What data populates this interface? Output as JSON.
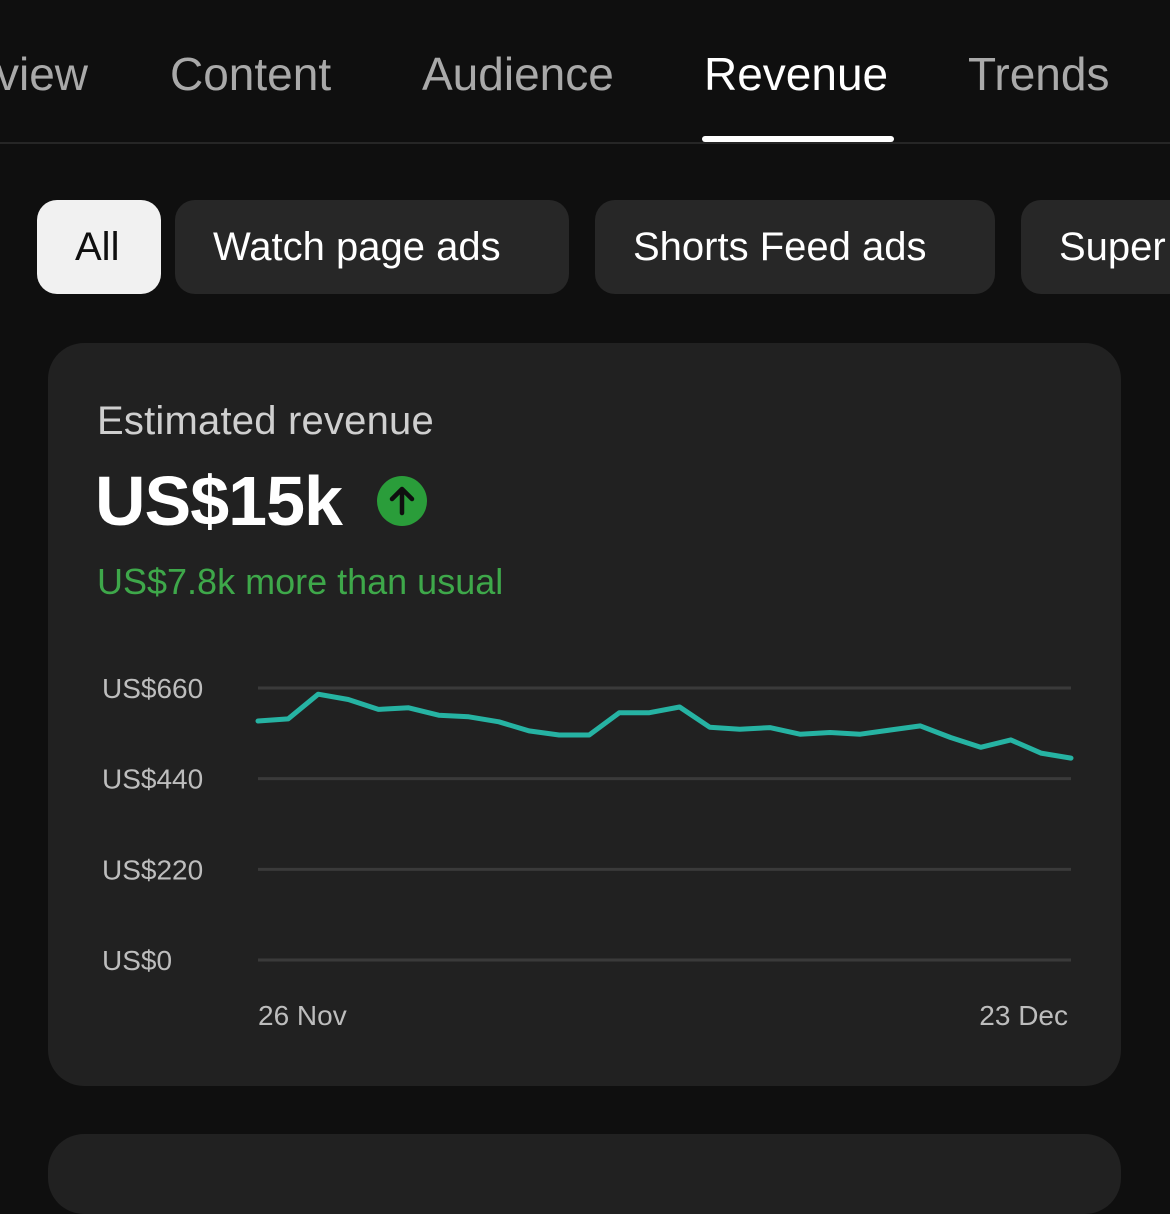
{
  "tabs": [
    {
      "label": "view",
      "active": false
    },
    {
      "label": "Content",
      "active": false
    },
    {
      "label": "Audience",
      "active": false
    },
    {
      "label": "Revenue",
      "active": true
    },
    {
      "label": "Trends",
      "active": false
    }
  ],
  "chips": [
    {
      "label": "All",
      "active": true
    },
    {
      "label": "Watch page ads",
      "active": false
    },
    {
      "label": "Shorts Feed ads",
      "active": false
    },
    {
      "label": "Super",
      "active": false
    }
  ],
  "card": {
    "title": "Estimated revenue",
    "value": "US$15k",
    "trend_icon": "arrow-up-circle-icon",
    "delta_text": "US$7.8k more than usual"
  },
  "colors": {
    "background": "#0f0f0f",
    "card": "#212121",
    "chip": "#272727",
    "chip_active": "#f1f1f1",
    "line": "#26b3a3",
    "positive": "#3ea84a",
    "gridline": "#3a3a3a"
  },
  "chart_data": {
    "type": "line",
    "ylim": [
      0,
      660
    ],
    "yticks": [
      0,
      220,
      440,
      660
    ],
    "ytick_labels": [
      "US$0",
      "US$220",
      "US$440",
      "US$660"
    ],
    "x_labels": {
      "first": "26 Nov",
      "last": "23 Dec"
    },
    "grid": true,
    "series": [
      {
        "values": [
          580,
          585,
          645,
          632,
          608,
          612,
          594,
          590,
          578,
          556,
          546,
          546,
          600,
          600,
          614,
          565,
          560,
          564,
          548,
          552,
          548,
          558,
          568,
          540,
          516,
          534,
          502,
          490
        ]
      }
    ]
  }
}
